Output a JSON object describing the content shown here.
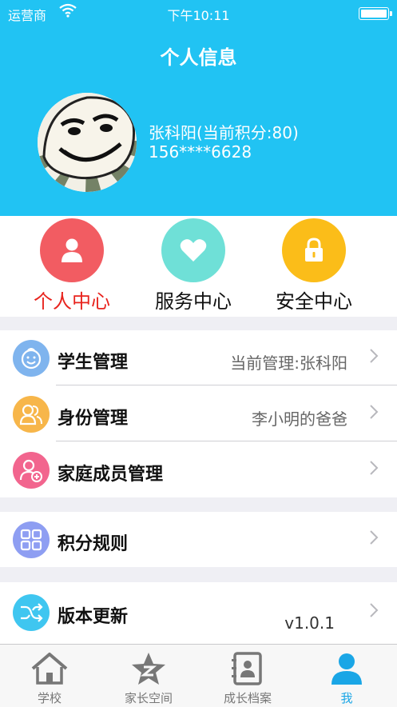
{
  "status_bar": {
    "carrier": "运营商",
    "time": "下午10:11"
  },
  "header": {
    "title": "个人信息"
  },
  "profile": {
    "name_line": "张科阳(当前积分:80)",
    "phone": "156****6628"
  },
  "quick_actions": [
    {
      "label": "个人中心",
      "color": "#f25c62",
      "icon": "person-icon",
      "active": true
    },
    {
      "label": "服务中心",
      "color": "#6fe0d7",
      "icon": "heart-icon",
      "active": false
    },
    {
      "label": "安全中心",
      "color": "#fbbd19",
      "icon": "lock-icon",
      "active": false
    }
  ],
  "menu": {
    "student": {
      "label": "学生管理",
      "value": "当前管理:张科阳",
      "color": "#7fb4ee",
      "icon": "baby-face-icon"
    },
    "identity": {
      "label": "身份管理",
      "value": "李小明的爸爸",
      "color": "#f7b64a",
      "icon": "users-icon"
    },
    "family": {
      "label": "家庭成员管理",
      "value": "",
      "color": "#f2658e",
      "icon": "add-user-icon"
    },
    "points": {
      "label": "积分规则",
      "value": "",
      "color": "#8e9ef2",
      "icon": "grid-icon"
    },
    "version": {
      "label": "版本更新",
      "value": "v1.0.1",
      "color": "#3fc6f0",
      "icon": "shuffle-icon"
    }
  },
  "tabbar": [
    {
      "label": "学校",
      "icon": "school-icon",
      "active": false
    },
    {
      "label": "家长空间",
      "icon": "star-icon",
      "active": false
    },
    {
      "label": "成长档案",
      "icon": "profile-card-icon",
      "active": false
    },
    {
      "label": "我",
      "icon": "me-icon",
      "active": true
    }
  ]
}
